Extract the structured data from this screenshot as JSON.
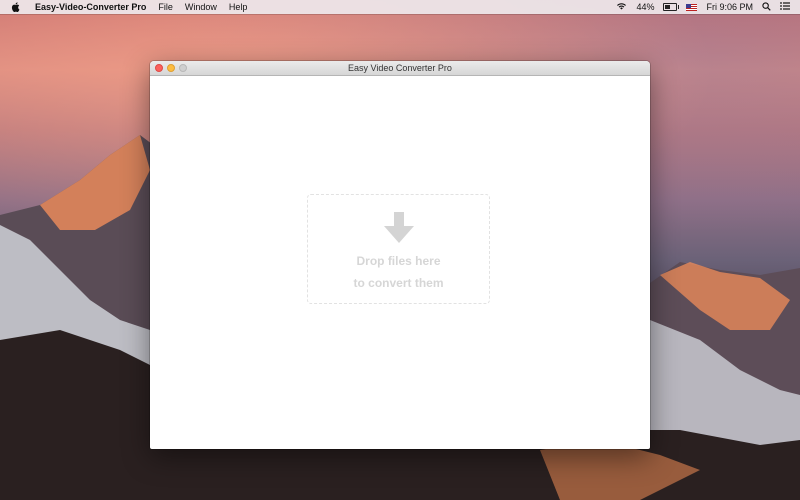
{
  "menubar": {
    "app_name": "Easy-Video-Converter Pro",
    "menus": [
      "File",
      "Window",
      "Help"
    ],
    "battery_percent": "44%",
    "battery_level": 0.44,
    "clock": "Fri 9:06 PM"
  },
  "window": {
    "title": "Easy Video Converter Pro"
  },
  "dropzone": {
    "line1": "Drop files here",
    "line2": "to convert them"
  },
  "icons": {
    "apple": "apple-logo-icon",
    "wifi": "wifi-icon",
    "battery": "battery-icon",
    "flag": "us-flag-icon",
    "search": "search-icon",
    "list": "list-icon",
    "arrow": "down-arrow-icon"
  },
  "colors": {
    "close": "#fc615d",
    "minimize": "#fdbc40",
    "zoom": "#cfcfcf",
    "drop_text": "#d6d6d6"
  }
}
